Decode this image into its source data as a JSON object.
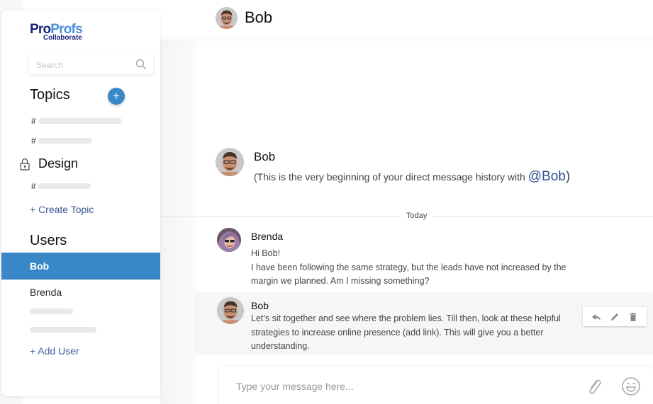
{
  "brand": {
    "logo_primary_a": "Pro",
    "logo_primary_b": "Profs",
    "logo_secondary": "Collaborate",
    "accent_color": "#3a87c8",
    "link_color": "#3d5a99"
  },
  "sidebar": {
    "search": {
      "placeholder": "Search",
      "value": "",
      "icon": "search-icon"
    },
    "topics": {
      "title": "Topics",
      "add_icon_label": "+",
      "items": [
        {
          "prefix": "#",
          "type": "placeholder"
        },
        {
          "prefix": "#",
          "type": "placeholder"
        }
      ],
      "private_group": {
        "icon": "lock-icon",
        "label": "Design",
        "items": [
          {
            "prefix": "#",
            "type": "placeholder"
          }
        ]
      },
      "create_label": "+ Create Topic"
    },
    "users": {
      "title": "Users",
      "items": [
        {
          "name": "Bob",
          "selected": true
        },
        {
          "name": "Brenda",
          "selected": false
        }
      ],
      "add_label": "+ Add User"
    }
  },
  "chat": {
    "header": {
      "name": "Bob"
    },
    "intro": {
      "name": "Bob",
      "text_prefix": "(This is the very beginning of your direct message history with ",
      "mention": "@Bob",
      "text_suffix": ")"
    },
    "day_divider": "Today",
    "messages": [
      {
        "author": "Brenda",
        "lines": [
          "Hi Bob!",
          "I have been following the same strategy, but the leads have not increased by the margin we planned. Am I missing something?"
        ]
      },
      {
        "author": "Bob",
        "lines": [
          "Let’s sit together and see where the problem lies. Till then, look at these helpful strategies to increase online presence (add link). This will give you a better understanding."
        ],
        "hovered": true,
        "actions": [
          "reply-icon",
          "edit-icon",
          "delete-icon"
        ]
      }
    ],
    "composer": {
      "placeholder": "Type your message here...",
      "value": "",
      "icons": [
        "attach-icon",
        "emoji-icon"
      ]
    }
  }
}
